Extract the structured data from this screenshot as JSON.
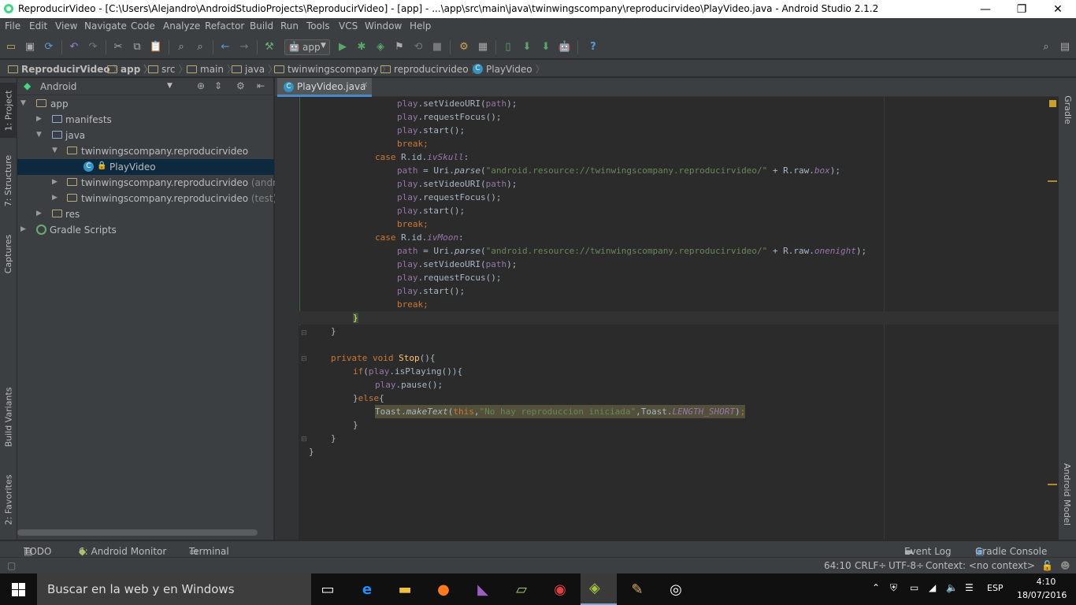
{
  "window": {
    "title": "ReproducirVideo - [C:\\Users\\Alejandro\\AndroidStudioProjects\\ReproducirVideo] - [app] - ...\\app\\src\\main\\java\\twinwingscompany\\reproducirvideo\\PlayVideo.java - Android Studio 2.1.2",
    "minimize": "—",
    "restore": "❐",
    "close": "✕"
  },
  "menu": [
    "File",
    "Edit",
    "View",
    "Navigate",
    "Code",
    "Analyze",
    "Refactor",
    "Build",
    "Run",
    "Tools",
    "VCS",
    "Window",
    "Help"
  ],
  "toolbar": {
    "run_config": "app",
    "help": "?"
  },
  "breadcrumbs": [
    "ReproducirVideo",
    "app",
    "src",
    "main",
    "java",
    "twinwingscompany",
    "reproducirvideo",
    "PlayVideo"
  ],
  "left_tabs": [
    "1: Project",
    "7: Structure",
    "Captures",
    "Build Variants",
    "2: Favorites"
  ],
  "right_tabs": [
    "Gradle",
    "Android Model"
  ],
  "project": {
    "view": "Android",
    "tree": [
      {
        "label": "app",
        "suffix": ""
      },
      {
        "label": "manifests",
        "suffix": ""
      },
      {
        "label": "java",
        "suffix": ""
      },
      {
        "label": "twinwingscompany.reproducirvideo",
        "suffix": ""
      },
      {
        "label": "PlayVideo",
        "suffix": ""
      },
      {
        "label": "twinwingscompany.reproducirvideo",
        "suffix": " (androidT"
      },
      {
        "label": "twinwingscompany.reproducirvideo",
        "suffix": " (test)"
      },
      {
        "label": "res",
        "suffix": ""
      },
      {
        "label": "Gradle Scripts",
        "suffix": ""
      }
    ]
  },
  "editor": {
    "tab": "PlayVideo.java"
  },
  "bottom_tools": {
    "todo": "TODO",
    "monitor": "6: Android Monitor",
    "terminal": "Terminal",
    "event_log": "Event Log",
    "gradle_console": "Gradle Console"
  },
  "status": {
    "position": "64:10",
    "line_sep": "CRLF÷",
    "encoding": "UTF-8÷",
    "context": "Context: <no context>"
  },
  "taskbar": {
    "search": "Buscar en la web y en Windows",
    "lang": "ESP",
    "time": "4:10",
    "date": "18/07/2016"
  }
}
